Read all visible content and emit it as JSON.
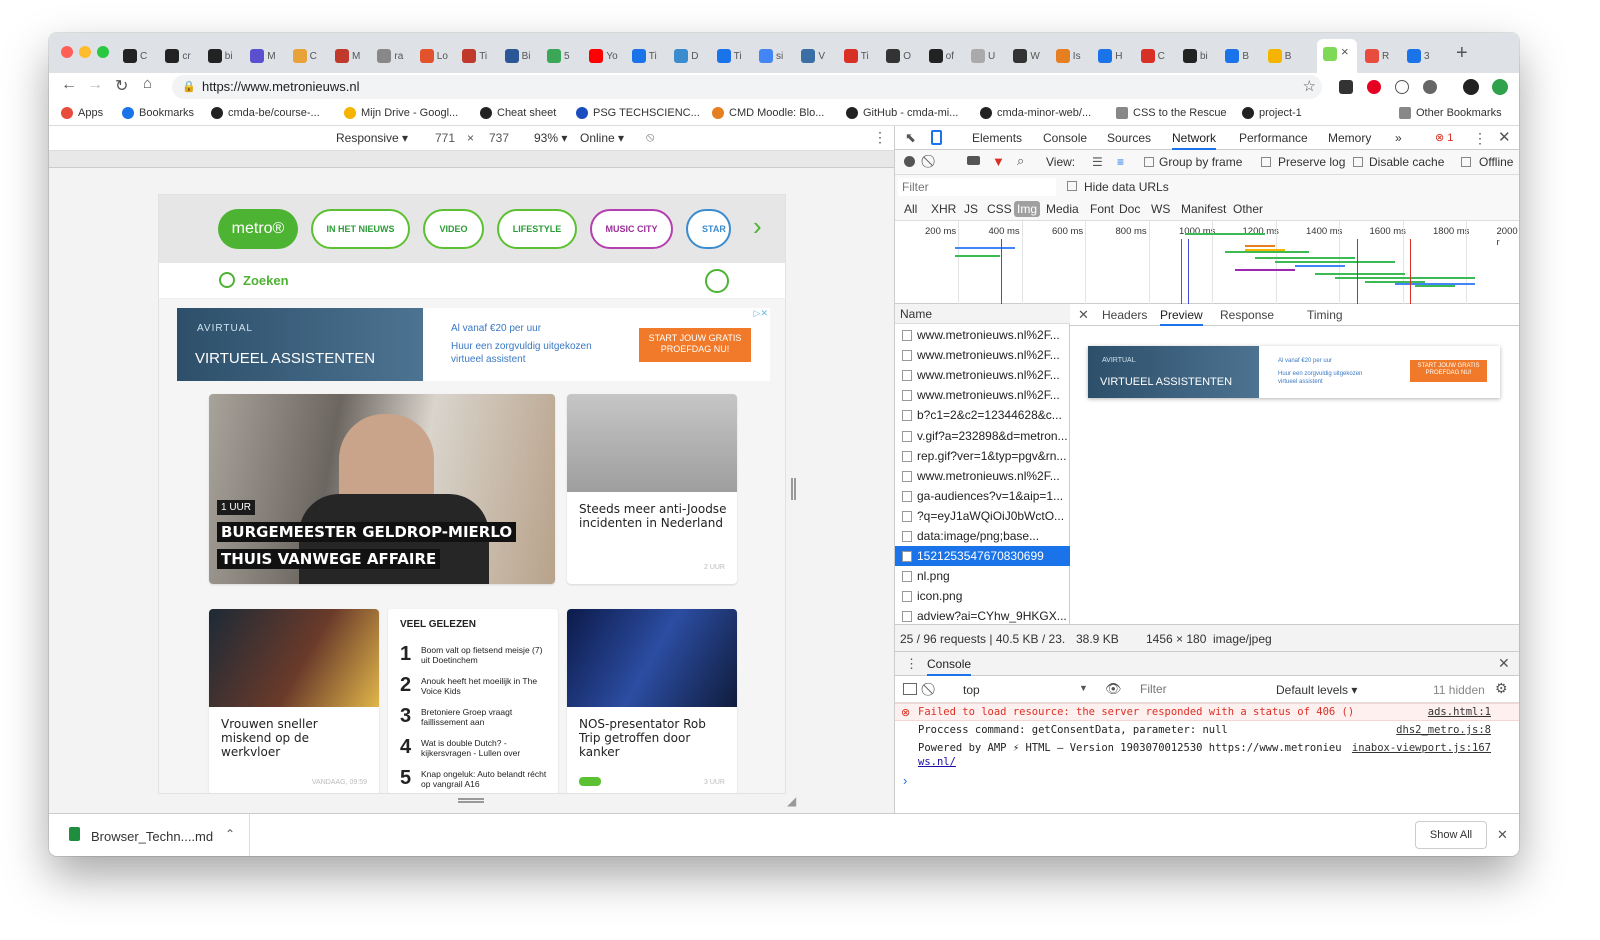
{
  "tabs": [
    "C",
    "cr",
    "bi",
    "M",
    "C",
    "M",
    "ra",
    "Lo",
    "Ti",
    "Bi",
    "5",
    "Yo",
    "Ti",
    "D",
    "Ti",
    "si",
    "V",
    "Ti",
    "O",
    "of",
    "U",
    "W",
    "Is",
    "H",
    "C",
    "bi",
    "B",
    "B",
    "",
    "R",
    "3"
  ],
  "address": {
    "url": "https://www.metronieuws.nl"
  },
  "bookmarks": [
    "Apps",
    "Bookmarks",
    "cmda-be/course-...",
    "Mijn Drive - Googl...",
    "Cheat sheet",
    "PSG TECHSCIENC...",
    "CMD Moodle: Blo...",
    "GitHub - cmda-mi...",
    "cmda-minor-web/...",
    "CSS to the Rescue",
    "project-1",
    "Other Bookmarks"
  ],
  "device": {
    "mode": "Responsive ▾",
    "width": "771",
    "times": "×",
    "height": "737",
    "zoom": "93% ▾",
    "network": "Online ▾"
  },
  "site": {
    "nav": [
      "IN HET NIEUWS",
      "VIDEO",
      "LIFESTYLE",
      "MUSIC CITY",
      "STAR"
    ],
    "logo": "metro",
    "search": "Zoeken",
    "ad": {
      "brand": "AVIRTUAL",
      "headline": "VIRTUEEL ASSISTENTEN",
      "line1": "Al vanaf €20 per uur",
      "line2": "Huur een zorgvuldig uitgekozen virtueel assistent",
      "cta": "START JOUW GRATIS PROEFDAG NU!"
    },
    "hero": {
      "badge": "1 UUR",
      "line1": "BURGEMEESTER GELDROP-MIERLO",
      "line2": "THUIS VANWEGE AFFAIRE"
    },
    "card2": {
      "title": "Steeds meer anti-Joodse incidenten in Nederland",
      "time": "2 UUR"
    },
    "card3": {
      "title": "Vrouwen sneller miskend op de werkvloer",
      "time": "VANDAAG, 09:59"
    },
    "popular": {
      "heading": "VEEL GELEZEN",
      "items": [
        {
          "n": "1",
          "t": "Boom valt op fietsend meisje (7) uit Doetinchem"
        },
        {
          "n": "2",
          "t": "Anouk heeft het moeilijk in The Voice Kids"
        },
        {
          "n": "3",
          "t": "Bretoniere Groep vraagt faillissement aan"
        },
        {
          "n": "4",
          "t": "Wat is double Dutch? - kijkersvragen - Lullen over"
        },
        {
          "n": "5",
          "t": "Knap ongeluk: Auto belandt récht op vangrail A16"
        }
      ]
    },
    "card4": {
      "title": "NOS-presentator Rob Trip getroffen door kanker",
      "time": "3 UUR"
    }
  },
  "devtools": {
    "tabs": [
      "Elements",
      "Console",
      "Sources",
      "Network",
      "Performance",
      "Memory",
      "»"
    ],
    "active_tab": "Network",
    "errors": "1",
    "toolbar": {
      "view": "View:",
      "group": "Group by frame",
      "preserve": "Preserve log",
      "cache": "Disable cache",
      "offline": "Offline"
    },
    "filter_placeholder": "Filter",
    "hide_urls": "Hide data URLs",
    "types": [
      "All",
      "XHR",
      "JS",
      "CSS",
      "Img",
      "Media",
      "Font",
      "Doc",
      "WS",
      "Manifest",
      "Other"
    ],
    "timeline_ticks": [
      "200 ms",
      "400 ms",
      "600 ms",
      "800 ms",
      "1000 ms",
      "1200 ms",
      "1400 ms",
      "1600 ms",
      "1800 ms",
      "2000 r"
    ],
    "name_header": "Name",
    "requests": [
      "www.metronieuws.nl%2F...",
      "www.metronieuws.nl%2F...",
      "www.metronieuws.nl%2F...",
      "www.metronieuws.nl%2F...",
      "b?c1=2&c2=12344628&c...",
      "v.gif?a=232898&d=metron...",
      "rep.gif?ver=1&typ=pgv&rn...",
      "www.metronieuws.nl%2F...",
      "ga-audiences?v=1&aip=1...",
      "?q=eyJ1aWQiOiJ0bWctO...",
      "data:image/png;base...",
      "1521253547670830699",
      "nl.png",
      "icon.png",
      "adview?ai=CYhw_9HKGX..."
    ],
    "selected_index": 11,
    "detail_tabs": [
      "Headers",
      "Preview",
      "Response",
      "Timing"
    ],
    "detail_active": "Preview",
    "status": {
      "requests": "25 / 96 requests | 40.5 KB / 23...",
      "size": "38.9 KB",
      "dims": "1456 × 180",
      "mime": "image/jpeg"
    },
    "console": {
      "title": "Console",
      "context": "top",
      "filter": "Filter",
      "levels": "Default levels ▾",
      "hidden": "11 hidden",
      "lines": [
        {
          "text": "Failed to load resource: the server responded with a status of 406 ()",
          "src": "ads.html:1",
          "error": true
        },
        {
          "text": "Proccess command: getConsentData, parameter: null",
          "src": "dhs2_metro.js:8",
          "error": false
        },
        {
          "text": "Powered by AMP ⚡ HTML – Version 1903070012530 https://www.metronieu",
          "text2": "ws.nl/",
          "src": "inabox-viewport.js:167",
          "error": false
        }
      ]
    }
  },
  "download": {
    "file": "Browser_Techn....md",
    "show_all": "Show All"
  }
}
